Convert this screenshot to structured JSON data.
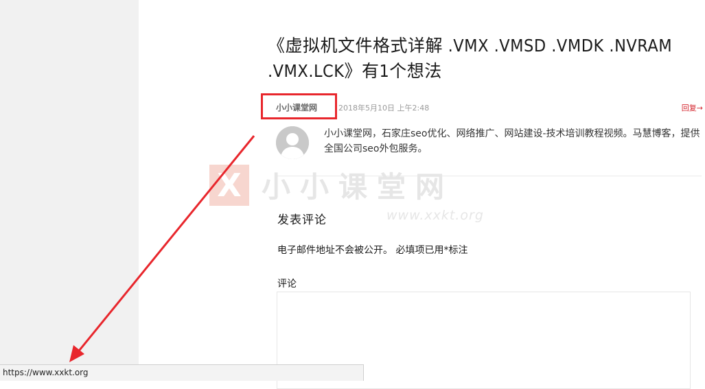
{
  "comments": {
    "title": "《虚拟机文件格式详解 .VMX .VMSD .VMDK .NVRAM .VMX.LCK》有1个想法",
    "items": [
      {
        "author": "小小课堂网",
        "date": "2018年5月10日 上午2:48",
        "reply_label": "回复→",
        "content": "小小课堂网，石家庄seo优化、网络推广、网站建设-技术培训教程视频。马慧博客，提供全国公司seo外包服务。",
        "avatar_icon": "default-user-avatar-icon"
      }
    ]
  },
  "watermark": {
    "logo_glyph": "X",
    "text": "小小课堂网",
    "url": "www.xxkt.org"
  },
  "reply_form": {
    "title": "发表评论",
    "notes": "电子邮件地址不会被公开。 必填项已用*标注",
    "comment_label": "评论",
    "comment_value": ""
  },
  "status_bar": {
    "url": "https://www.xxkt.org"
  },
  "annotation": {
    "highlight_color": "#e8262c",
    "arrow_color": "#e8262c"
  }
}
